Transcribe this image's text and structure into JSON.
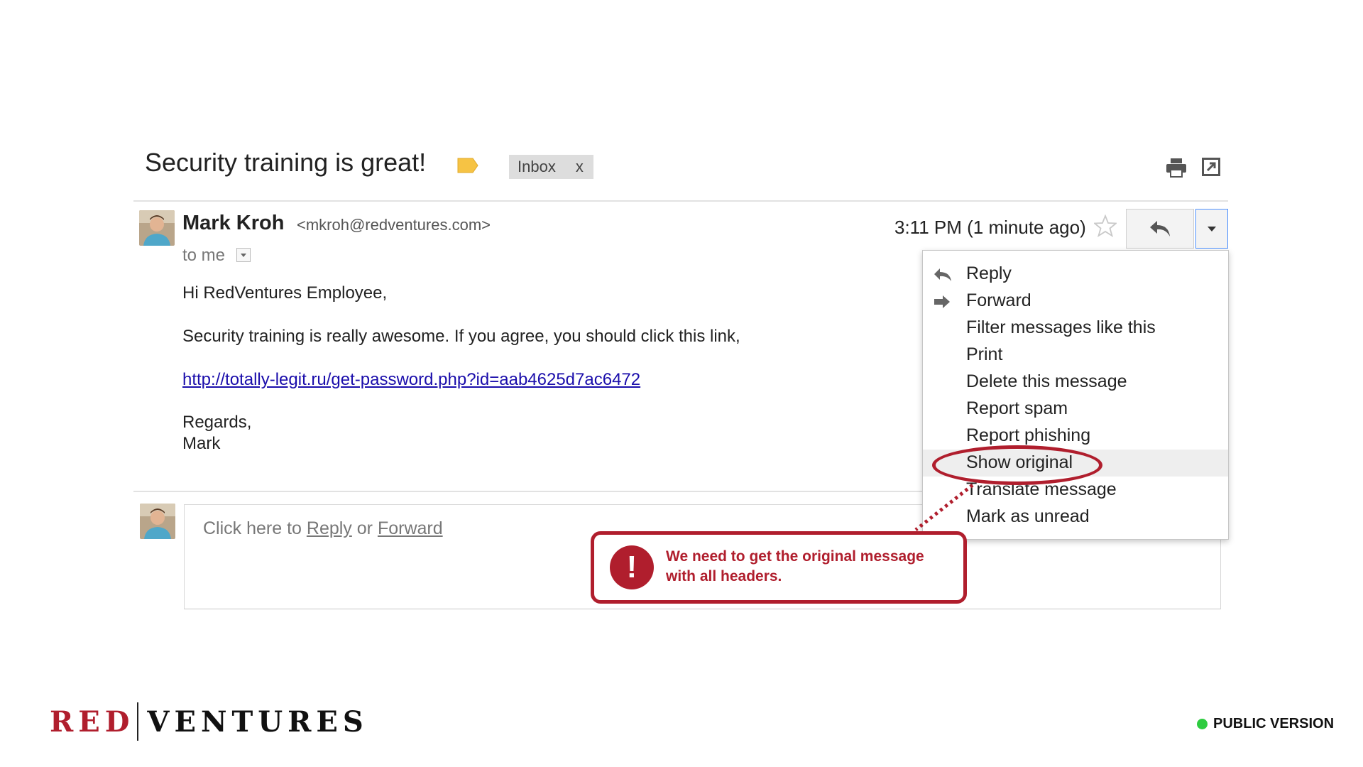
{
  "email": {
    "subject": "Security training is great!",
    "labels": [
      {
        "name": "Inbox",
        "remove": "x"
      }
    ],
    "sender": {
      "name": "Mark Kroh",
      "email": "<mkroh@redventures.com>"
    },
    "recipient": "to me",
    "timestamp": "3:11 PM (1 minute ago)",
    "body": {
      "greeting": "Hi RedVentures Employee,",
      "paragraph": "Security training is really awesome. If you agree, you should click this link,",
      "link": "http://totally-legit.ru/get-password.php?id=aab4625d7ac6472",
      "signoff": "Regards,",
      "signature": "Mark"
    }
  },
  "reply_box": {
    "prefix": "Click here to ",
    "reply": "Reply",
    "or": " or ",
    "forward": "Forward"
  },
  "menu": {
    "items": [
      {
        "label": "Reply",
        "icon": "reply-icon"
      },
      {
        "label": "Forward",
        "icon": "forward-icon"
      },
      {
        "label": "Filter messages like this"
      },
      {
        "label": "Print"
      },
      {
        "label": "Delete this message"
      },
      {
        "label": "Report spam"
      },
      {
        "label": "Report phishing"
      },
      {
        "label": "Show original",
        "highlighted": true
      },
      {
        "label": "Translate message"
      },
      {
        "label": "Mark as unread"
      }
    ]
  },
  "annotation": {
    "icon": "!",
    "text": "We need to get the original message with all headers."
  },
  "footer": {
    "logo_left": "RED",
    "logo_right": "VENTURES",
    "badge": "PUBLIC VERSION"
  },
  "colors": {
    "brand_red": "#b01e2d",
    "label_yellow": "#f6c344",
    "link_blue": "#1a0dab",
    "status_green": "#2ecc40",
    "focus_blue": "#4d90fe"
  },
  "icons": [
    "label-icon",
    "print-icon",
    "popout-icon",
    "star-icon",
    "reply-icon",
    "dropdown-arrow-icon",
    "forward-icon"
  ]
}
